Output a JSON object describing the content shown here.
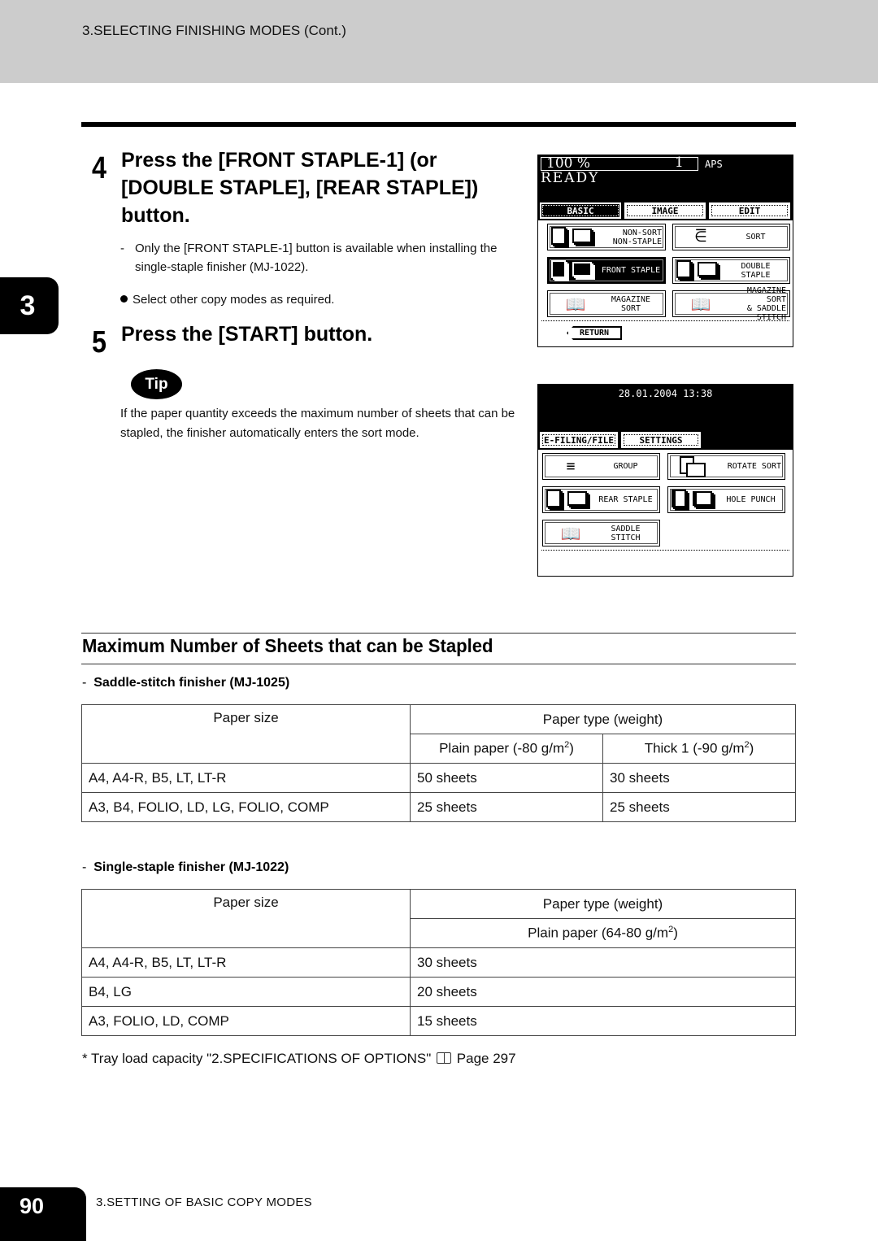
{
  "header": {
    "title": "3.SELECTING FINISHING MODES (Cont.)"
  },
  "chapter_tab": "3",
  "steps": [
    {
      "number": "4",
      "title_lines": [
        "Press the [FRONT STAPLE-1] (or",
        "[DOUBLE STAPLE], [REAR STAPLE])",
        "button."
      ],
      "notes": [
        "Only the [FRONT STAPLE-1] button is available when installing the single-staple finisher (MJ-1022)."
      ],
      "bullets": [
        "Select other copy modes as required."
      ]
    },
    {
      "number": "5",
      "title_lines": [
        "Press the [START] button."
      ]
    }
  ],
  "tip": {
    "badge": "Tip",
    "text": "If the paper quantity exceeds the maximum number of sheets that can be stapled, the finisher automatically enters the sort mode."
  },
  "panel_basic": {
    "zoom": "100  %",
    "count": "1",
    "paper": "APS",
    "status": "READY",
    "tabs": [
      "BASIC",
      "IMAGE",
      "EDIT"
    ],
    "active_tab": "BASIC",
    "buttons": [
      {
        "label_lines": [
          "NON-SORT",
          "NON-STAPLE"
        ],
        "icon": "non-sort-icon",
        "selected": false
      },
      {
        "label_lines": [
          "SORT"
        ],
        "icon": "sort-icon",
        "selected": false
      },
      {
        "label_lines": [
          "FRONT STAPLE"
        ],
        "icon": "front-staple-icon",
        "selected": true
      },
      {
        "label_lines": [
          "DOUBLE STAPLE"
        ],
        "icon": "double-staple-icon",
        "selected": false
      },
      {
        "label_lines": [
          "MAGAZINE SORT"
        ],
        "icon": "magazine-sort-icon",
        "selected": false
      },
      {
        "label_lines": [
          "MAGAZINE SORT",
          "& SADDLE STITCH"
        ],
        "icon": "saddle-stitch-icon",
        "selected": false
      }
    ],
    "return_label": "RETURN"
  },
  "panel_edit": {
    "datetime": "28.01.2004 13:38",
    "tabs": [
      "E-FILING/FILE",
      "SETTINGS"
    ],
    "buttons": [
      {
        "label_lines": [
          "GROUP"
        ],
        "icon": "group-icon"
      },
      {
        "label_lines": [
          "ROTATE SORT"
        ],
        "icon": "rotate-sort-icon"
      },
      {
        "label_lines": [
          "REAR  STAPLE"
        ],
        "icon": "rear-staple-icon"
      },
      {
        "label_lines": [
          "HOLE PUNCH"
        ],
        "icon": "hole-punch-icon"
      },
      {
        "label_lines": [
          "SADDLE  STITCH"
        ],
        "icon": "saddle-stitch-icon"
      }
    ]
  },
  "section": {
    "title": "Maximum Number of Sheets that can be Stapled",
    "tables": [
      {
        "heading_dash": "-",
        "heading": "Saddle-stitch finisher (MJ-1025)",
        "header_col1": "Paper size",
        "header_group": "Paper type (weight)",
        "subheaders": [
          {
            "text": "Plain paper (-80 g/m",
            "sup": "2",
            "close": ")"
          },
          {
            "text": "Thick 1 (-90 g/m",
            "sup": "2",
            "close": ")"
          }
        ],
        "rows": [
          [
            "A4, A4-R, B5, LT, LT-R",
            "50 sheets",
            "30 sheets"
          ],
          [
            "A3, B4, FOLIO, LD, LG, FOLIO, COMP",
            "25 sheets",
            "25 sheets"
          ]
        ]
      },
      {
        "heading_dash": "-",
        "heading": "Single-staple finisher (MJ-1022)",
        "header_col1": "Paper size",
        "header_group": "Paper type (weight)",
        "subheaders": [
          {
            "text": "Plain paper (64-80 g/m",
            "sup": "2",
            "close": ")"
          }
        ],
        "rows": [
          [
            "A4, A4-R, B5, LT, LT-R",
            "30 sheets"
          ],
          [
            "B4, LG",
            "20 sheets"
          ],
          [
            "A3, FOLIO, LD, COMP",
            "15 sheets"
          ]
        ]
      }
    ],
    "footnote": {
      "prefix": "*  Tray load capacity \"2.SPECIFICATIONS OF OPTIONS\"",
      "icon": "book-icon",
      "suffix": "Page 297"
    }
  },
  "footer": {
    "page_number": "90",
    "label": "3.SETTING OF BASIC COPY MODES"
  }
}
